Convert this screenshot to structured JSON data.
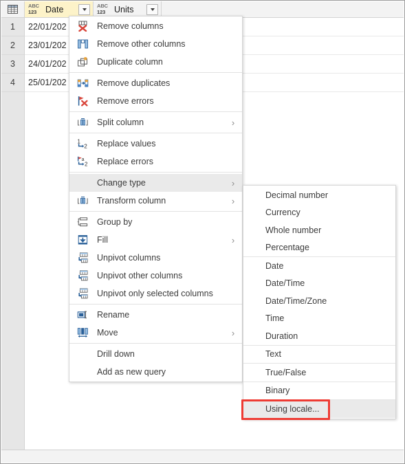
{
  "grid": {
    "corner_icon": "select-all-table-icon",
    "columns": [
      {
        "name": "Date",
        "type_icon": "abc123-any-type-icon",
        "selected": true,
        "filter_icon": "filter-dropdown-icon"
      },
      {
        "name": "Units",
        "type_icon": "abc123-any-type-icon",
        "selected": false,
        "filter_icon": "filter-dropdown-icon"
      }
    ],
    "rows": [
      {
        "num": "1",
        "date": "22/01/202",
        "units": ""
      },
      {
        "num": "2",
        "date": "23/01/202",
        "units": ""
      },
      {
        "num": "3",
        "date": "24/01/202",
        "units": ""
      },
      {
        "num": "4",
        "date": "25/01/202",
        "units": ""
      }
    ]
  },
  "context_menu": {
    "items": [
      {
        "label": "Remove columns",
        "icon": "remove-columns-icon",
        "arrow": false,
        "highlight": false,
        "sep_after": false
      },
      {
        "label": "Remove other columns",
        "icon": "remove-other-columns-icon",
        "arrow": false,
        "highlight": false,
        "sep_after": false
      },
      {
        "label": "Duplicate column",
        "icon": "duplicate-column-icon",
        "arrow": false,
        "highlight": false,
        "sep_after": true
      },
      {
        "label": "Remove duplicates",
        "icon": "remove-duplicates-icon",
        "arrow": false,
        "highlight": false,
        "sep_after": false
      },
      {
        "label": "Remove errors",
        "icon": "remove-errors-icon",
        "arrow": false,
        "highlight": false,
        "sep_after": true
      },
      {
        "label": "Split column",
        "icon": "split-column-icon",
        "arrow": true,
        "highlight": false,
        "sep_after": true
      },
      {
        "label": "Replace values",
        "icon": "replace-values-icon",
        "arrow": false,
        "highlight": false,
        "sep_after": false
      },
      {
        "label": "Replace errors",
        "icon": "replace-errors-icon",
        "arrow": false,
        "highlight": false,
        "sep_after": true
      },
      {
        "label": "Change type",
        "icon": "none",
        "arrow": true,
        "highlight": true,
        "sep_after": false
      },
      {
        "label": "Transform column",
        "icon": "transform-column-icon",
        "arrow": true,
        "highlight": false,
        "sep_after": true
      },
      {
        "label": "Group by",
        "icon": "group-by-icon",
        "arrow": false,
        "highlight": false,
        "sep_after": false
      },
      {
        "label": "Fill",
        "icon": "fill-icon",
        "arrow": true,
        "highlight": false,
        "sep_after": false
      },
      {
        "label": "Unpivot columns",
        "icon": "unpivot-columns-icon",
        "arrow": false,
        "highlight": false,
        "sep_after": false
      },
      {
        "label": "Unpivot other columns",
        "icon": "unpivot-other-columns-icon",
        "arrow": false,
        "highlight": false,
        "sep_after": false
      },
      {
        "label": "Unpivot only selected columns",
        "icon": "unpivot-only-selected-columns-icon",
        "arrow": false,
        "highlight": false,
        "sep_after": true
      },
      {
        "label": "Rename",
        "icon": "rename-icon",
        "arrow": false,
        "highlight": false,
        "sep_after": false
      },
      {
        "label": "Move",
        "icon": "move-icon",
        "arrow": true,
        "highlight": false,
        "sep_after": true
      },
      {
        "label": "Drill down",
        "icon": "none",
        "arrow": false,
        "highlight": false,
        "sep_after": false
      },
      {
        "label": "Add as new query",
        "icon": "none",
        "arrow": false,
        "highlight": false,
        "sep_after": false
      }
    ]
  },
  "change_type_submenu": {
    "items": [
      {
        "label": "Decimal number",
        "highlight": false,
        "sep_after": false,
        "boxed": false
      },
      {
        "label": "Currency",
        "highlight": false,
        "sep_after": false,
        "boxed": false
      },
      {
        "label": "Whole number",
        "highlight": false,
        "sep_after": false,
        "boxed": false
      },
      {
        "label": "Percentage",
        "highlight": false,
        "sep_after": true,
        "boxed": false
      },
      {
        "label": "Date",
        "highlight": false,
        "sep_after": false,
        "boxed": false
      },
      {
        "label": "Date/Time",
        "highlight": false,
        "sep_after": false,
        "boxed": false
      },
      {
        "label": "Date/Time/Zone",
        "highlight": false,
        "sep_after": false,
        "boxed": false
      },
      {
        "label": "Time",
        "highlight": false,
        "sep_after": false,
        "boxed": false
      },
      {
        "label": "Duration",
        "highlight": false,
        "sep_after": true,
        "boxed": false
      },
      {
        "label": "Text",
        "highlight": false,
        "sep_after": true,
        "boxed": false
      },
      {
        "label": "True/False",
        "highlight": false,
        "sep_after": true,
        "boxed": false
      },
      {
        "label": "Binary",
        "highlight": false,
        "sep_after": true,
        "boxed": false
      },
      {
        "label": "Using locale...",
        "highlight": true,
        "sep_after": false,
        "boxed": true
      }
    ]
  },
  "annotation": {
    "highlight_color": "#ee3b33",
    "target_label": "Using locale..."
  },
  "colors": {
    "selected_column": "#fdf3c9",
    "menu_highlight": "#eaeaea",
    "gutter": "#e6e6e6",
    "header": "#f3f3f3"
  }
}
